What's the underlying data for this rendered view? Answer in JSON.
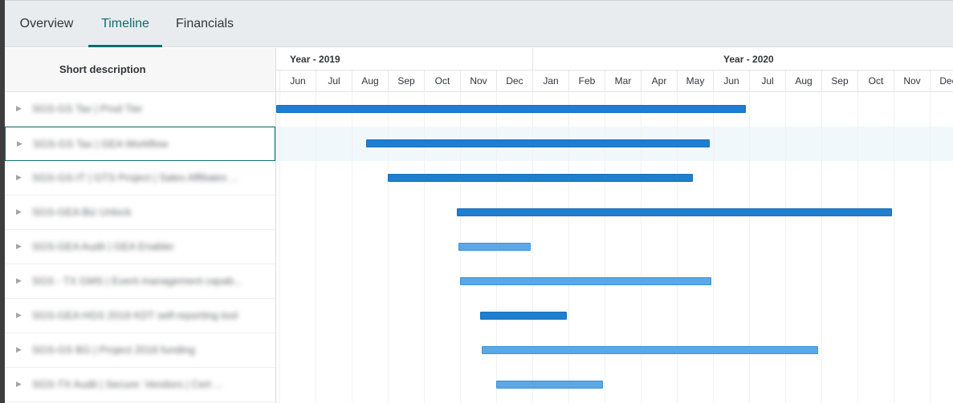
{
  "tabs": [
    {
      "label": "Overview",
      "active": false
    },
    {
      "label": "Timeline",
      "active": true
    },
    {
      "label": "Financials",
      "active": false
    }
  ],
  "left_panel": {
    "header": "Short description",
    "rows": [
      {
        "label": "SGS-GS Tax | Prod Tier",
        "selected": false
      },
      {
        "label": "SGS-GS Tax | GEA Workflow",
        "selected": true
      },
      {
        "label": "SGS-GS-IT | GTS Project | Sales Affiliates ...",
        "selected": false
      },
      {
        "label": "SGS-GEA Biz Unlock",
        "selected": false
      },
      {
        "label": "SGS-GEA Audit | GEA Enabler",
        "selected": false
      },
      {
        "label": "SGS - TX GMS | Event management capab...",
        "selected": false
      },
      {
        "label": "SGS-GEA HGS 2019 KDT self-reporting tool",
        "selected": false
      },
      {
        "label": "SGS-GS BG | Project 2018 funding",
        "selected": false
      },
      {
        "label": "SGS-TX Audit | Secure: Vendors | Cert ...",
        "selected": false
      }
    ]
  },
  "timeline": {
    "years": [
      "Year - 2019",
      "Year - 2020"
    ],
    "months": [
      "Jun",
      "Jul",
      "Aug",
      "Sep",
      "Oct",
      "Nov",
      "Dec",
      "Jan",
      "Feb",
      "Mar",
      "Apr",
      "May",
      "Jun",
      "Jul",
      "Aug",
      "Sep",
      "Oct",
      "Nov",
      "Dec"
    ],
    "start_month_index": -0.1,
    "bars": [
      {
        "start": -0.1,
        "end": 12.9,
        "style": "dark"
      },
      {
        "start": 2.4,
        "end": 11.9,
        "style": "dark"
      },
      {
        "start": 3.0,
        "end": 11.45,
        "style": "dark"
      },
      {
        "start": 4.9,
        "end": 16.95,
        "style": "dark"
      },
      {
        "start": 4.95,
        "end": 6.95,
        "style": "light"
      },
      {
        "start": 5.0,
        "end": 11.95,
        "style": "light"
      },
      {
        "start": 5.55,
        "end": 7.95,
        "style": "dark"
      },
      {
        "start": 5.6,
        "end": 14.9,
        "style": "light"
      },
      {
        "start": 6.0,
        "end": 8.95,
        "style": "light"
      }
    ]
  },
  "colors": {
    "accent": "#0a6e6e",
    "bar_dark": "#1f7ecf",
    "bar_light": "#5aa8e6",
    "selected_row_bg": "#f1f8fb"
  }
}
